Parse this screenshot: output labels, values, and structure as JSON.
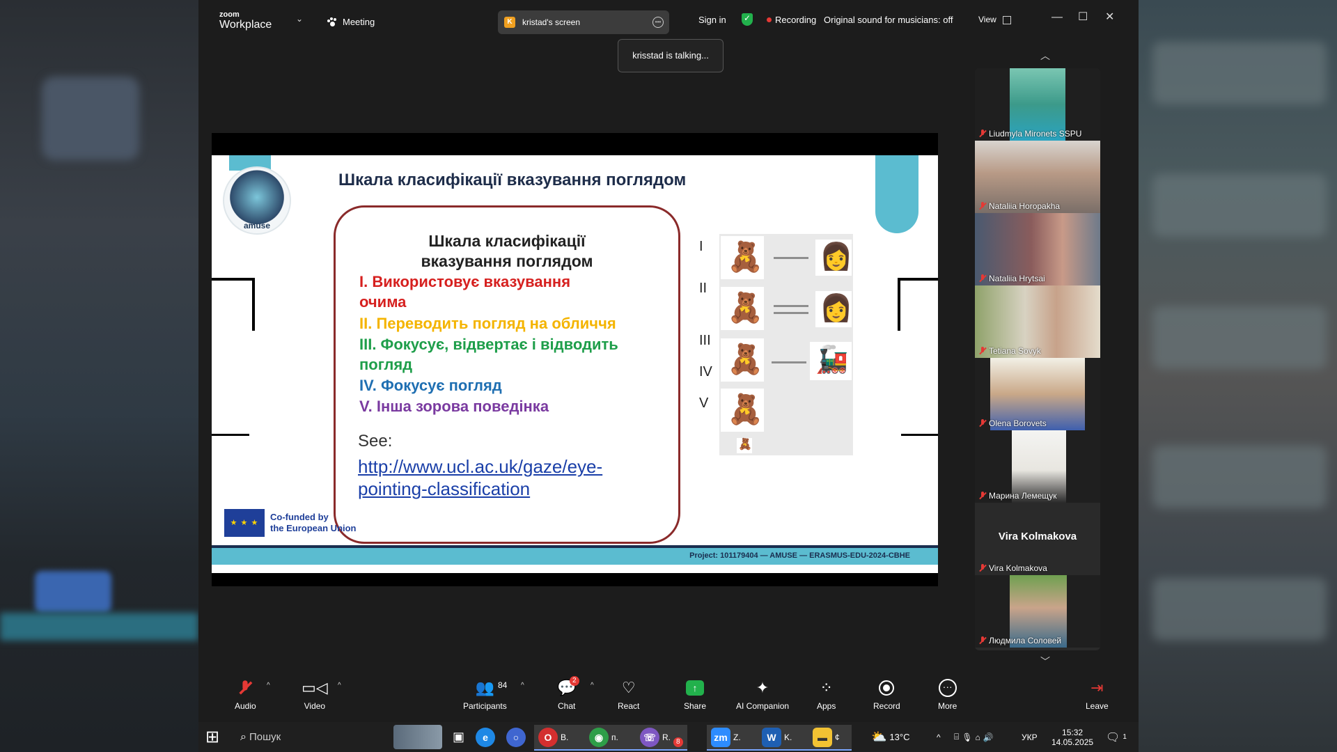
{
  "app": {
    "brand_small": "zoom",
    "brand_large": "Workplace",
    "meeting_label": "Meeting",
    "screen_share_initial": "K",
    "screen_share_label": "kristad's screen",
    "sign_in": "Sign in",
    "recording": "Recording",
    "original_sound": "Original sound for musicians: off",
    "view": "View"
  },
  "toast": "krisstad is talking...",
  "slide": {
    "title": "Шкала класифікації вказування поглядом",
    "logo_label": "amuse",
    "card_heading_1": "Шкала класифікації",
    "card_heading_2": "вказування поглядом",
    "item_1a": "I. Використовує вказування",
    "item_1b": "очима",
    "item_2": "II. Переводить погляд на обличчя",
    "item_3a": "III. Фокусує, відвертає і відводить",
    "item_3b": "погляд",
    "item_4": "IV. Фокусує погляд",
    "item_5": "V. Інша зорова поведінка",
    "see": "See:",
    "link_1": "http://www.ucl.ac.uk/gaze/eye-",
    "link_2": "pointing-classification",
    "roman": [
      "I",
      "II",
      "III",
      "IV",
      "V"
    ],
    "eu_line1": "Co-funded by",
    "eu_line2": "the European Union",
    "project": "Project: 101179404 — AMUSE — ERASMUS-EDU-2024-CBHE",
    "colors": {
      "item1": "#d6201f",
      "item2": "#f4b400",
      "item3": "#1e9e4a",
      "item4": "#1f6fb2",
      "item5": "#7a3aa0"
    }
  },
  "participants": [
    {
      "name": "Liudmyla Mironets SSPU",
      "muted": true
    },
    {
      "name": "Nataliia Horopakha",
      "muted": true
    },
    {
      "name": "Nataliia Hrytsai",
      "muted": true
    },
    {
      "name": "Tetiana Sovyk",
      "muted": true
    },
    {
      "name": "Olena Borovets",
      "muted": true
    },
    {
      "name": "Марина Лемещук",
      "muted": true
    },
    {
      "name": "Vira Kolmakova",
      "muted": true,
      "video": false
    },
    {
      "name": "Людмила Соловей",
      "muted": true
    }
  ],
  "vira_big": "Vira Kolmakova",
  "toolbar": {
    "audio": "Audio",
    "video": "Video",
    "participants": "Participants",
    "participants_count": "84",
    "chat": "Chat",
    "chat_badge": "2",
    "react": "React",
    "share": "Share",
    "ai": "AI Companion",
    "apps": "Apps",
    "record": "Record",
    "more": "More",
    "leave": "Leave"
  },
  "taskbar": {
    "search": "Пошук",
    "b1": "В.",
    "b2": "п.",
    "b3": "R.",
    "b3_badge": "8",
    "b4": "Z.",
    "b5": "K.",
    "b6": "¢",
    "temp": "13°C",
    "lang": "УКР",
    "time": "15:32",
    "date": "14.05.2025",
    "notif": "1"
  }
}
